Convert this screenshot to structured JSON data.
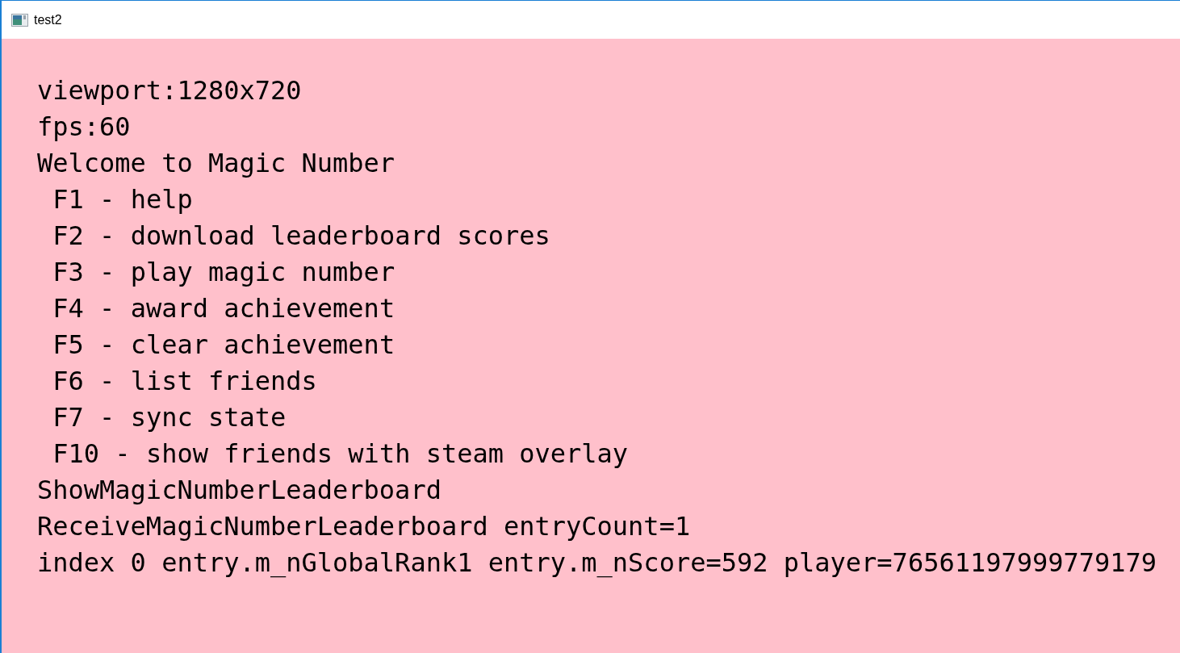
{
  "window": {
    "title": "test2"
  },
  "console": {
    "lines": [
      {
        "kind": "text",
        "text": "viewport:1280x720"
      },
      {
        "kind": "text",
        "text": "fps:60"
      },
      {
        "kind": "text",
        "text": "Welcome to Magic Number"
      },
      {
        "kind": "option",
        "text": "F1 - help"
      },
      {
        "kind": "option",
        "text": "F2 - download leaderboard scores"
      },
      {
        "kind": "option",
        "text": "F3 - play magic number"
      },
      {
        "kind": "option",
        "text": "F4 - award achievement"
      },
      {
        "kind": "option",
        "text": "F5 - clear achievement"
      },
      {
        "kind": "option",
        "text": "F6 - list friends"
      },
      {
        "kind": "option",
        "text": "F7 - sync state"
      },
      {
        "kind": "option",
        "text": "F10 - show friends with steam overlay"
      },
      {
        "kind": "text",
        "text": "ShowMagicNumberLeaderboard"
      },
      {
        "kind": "text",
        "text": "ReceiveMagicNumberLeaderboard entryCount=1"
      },
      {
        "kind": "text",
        "text": "index 0 entry.m_nGlobalRank1 entry.m_nScore=592 player=76561197999779179"
      }
    ]
  }
}
